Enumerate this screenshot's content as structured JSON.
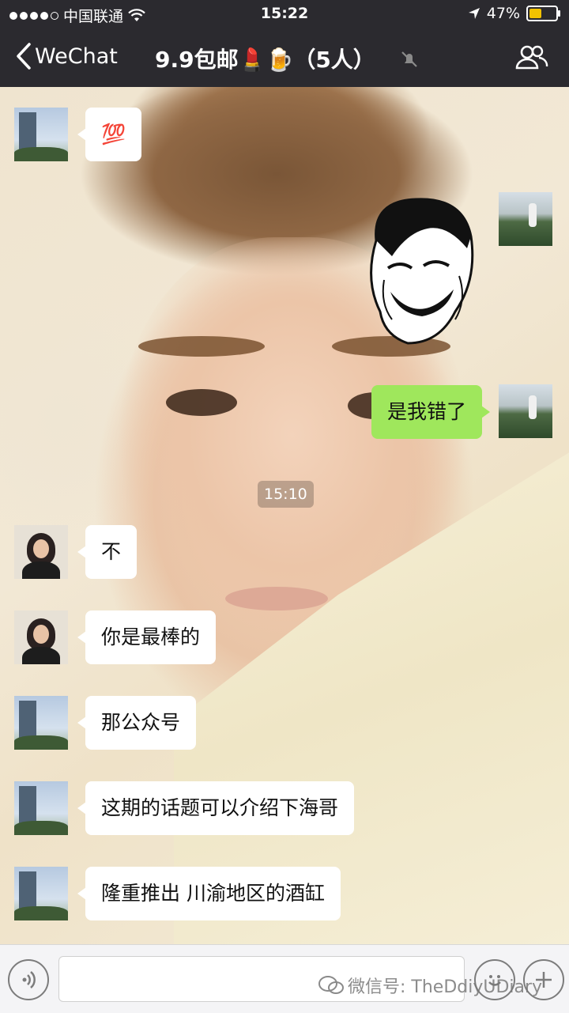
{
  "status_bar": {
    "carrier": "中国联通",
    "time": "15:22",
    "battery_percent": "47%",
    "battery_level": 0.47
  },
  "nav": {
    "back_label": "WeChat",
    "title": "9.9包邮💄🍺（5人）"
  },
  "messages": [
    {
      "side": "left",
      "text": "💯"
    },
    {
      "side": "right",
      "type": "sticker",
      "sticker": "troll-face-laughing"
    },
    {
      "side": "right",
      "text": "是我错了"
    },
    {
      "type": "timestamp",
      "text": "15:10"
    },
    {
      "side": "left",
      "text": "不"
    },
    {
      "side": "left",
      "text": "你是最棒的"
    },
    {
      "side": "left",
      "text": "那公众号"
    },
    {
      "side": "left",
      "text": "这期的话题可以介绍下海哥"
    },
    {
      "side": "left",
      "text": "隆重推出 川渝地区的酒缸"
    }
  ],
  "watermark": "微信号: TheDdiyUDiary",
  "colors": {
    "bar_bg": "#2b2a2f",
    "sent_bubble": "#9fe75c",
    "received_bubble": "#ffffff",
    "battery_fill": "#f2c200"
  },
  "icons": {
    "back": "chevron-left-icon",
    "mute": "bell-muted-icon",
    "members": "group-icon",
    "voice": "voice-icon",
    "emoji": "emoji-icon",
    "more": "plus-icon"
  }
}
